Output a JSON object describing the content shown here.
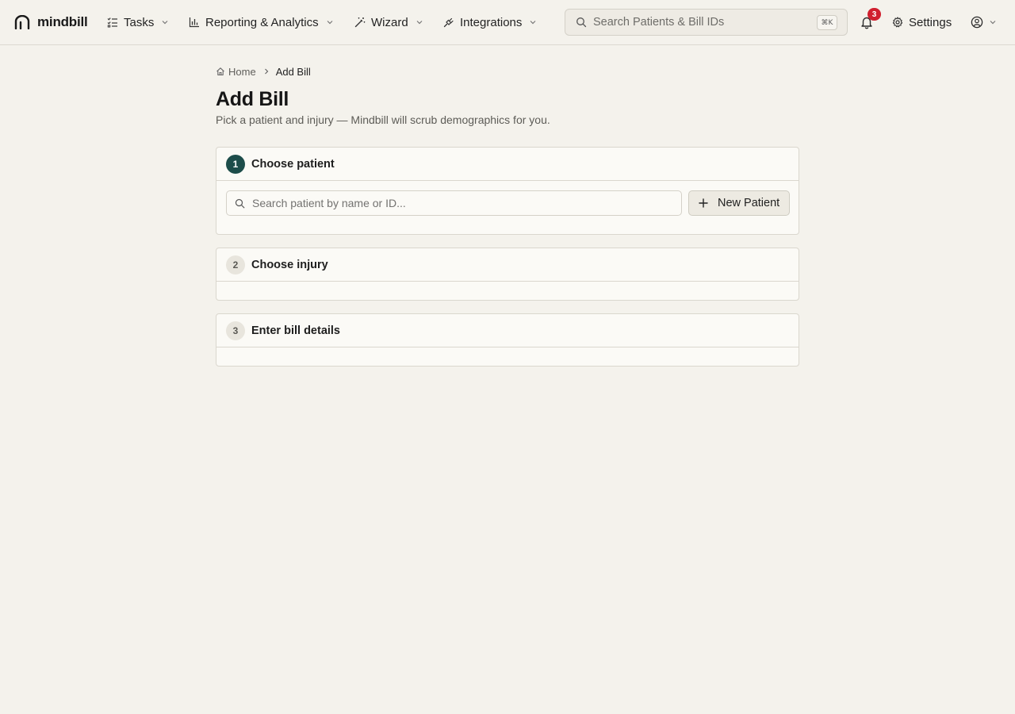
{
  "app": {
    "name": "mindbill"
  },
  "nav": {
    "items": [
      {
        "label": "Tasks",
        "icon": "tasks-icon"
      },
      {
        "label": "Reporting & Analytics",
        "icon": "bar-chart-icon"
      },
      {
        "label": "Wizard",
        "icon": "magic-wand-icon"
      },
      {
        "label": "Integrations",
        "icon": "plug-icon"
      }
    ]
  },
  "header": {
    "search_placeholder": "Search Patients & Bill IDs",
    "search_shortcut": "⌘K",
    "notification_count": "3",
    "settings_label": "Settings"
  },
  "breadcrumb": {
    "home": "Home",
    "current": "Add Bill"
  },
  "page": {
    "title": "Add Bill",
    "subtitle": "Pick a patient and injury — Mindbill will scrub demographics for you."
  },
  "steps": [
    {
      "number": "1",
      "title": "Choose patient",
      "active": true
    },
    {
      "number": "2",
      "title": "Choose injury",
      "active": false
    },
    {
      "number": "3",
      "title": "Enter bill details",
      "active": false
    }
  ],
  "patient_step": {
    "search_placeholder": "Search patient by name or ID...",
    "new_patient_label": "New Patient"
  },
  "colors": {
    "background": "#f4f2ec",
    "accent": "#1d4d4a",
    "badge": "#d01f2e"
  }
}
